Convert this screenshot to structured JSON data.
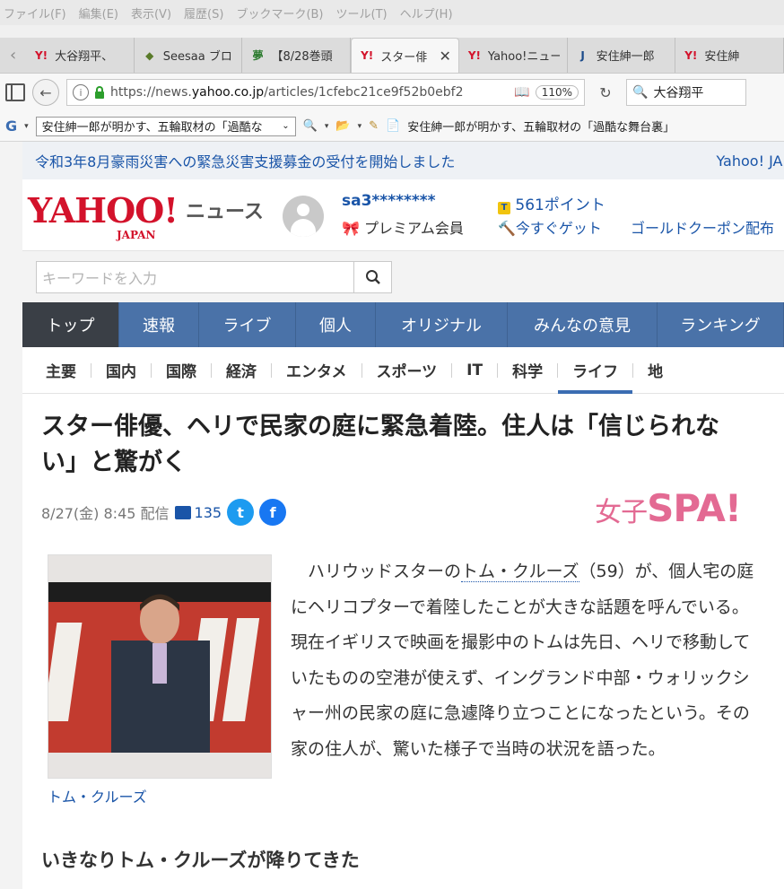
{
  "menubar": [
    "ファイル(F)",
    "編集(E)",
    "表示(V)",
    "履歴(S)",
    "ブックマーク(B)",
    "ツール(T)",
    "ヘルプ(H)"
  ],
  "tabs": [
    {
      "label": "大谷翔平、",
      "favicon": "Y!",
      "active": false,
      "color": "#d3122b"
    },
    {
      "label": "Seesaa ブロ",
      "favicon": "◆",
      "active": false,
      "color": "#5a7b2a"
    },
    {
      "label": "【8/28巻頭",
      "favicon": "夢",
      "active": false,
      "color": "#2b7b2e"
    },
    {
      "label": "スター俳",
      "favicon": "Y!",
      "active": true,
      "color": "#d3122b"
    },
    {
      "label": "Yahoo!ニュー",
      "favicon": "Y!",
      "active": false,
      "color": "#d3122b"
    },
    {
      "label": "安住紳一郎",
      "favicon": "J",
      "active": false,
      "color": "#1a4a8a"
    },
    {
      "label": "安住紳",
      "favicon": "Y!",
      "active": false,
      "color": "#d3122b"
    }
  ],
  "nav": {
    "url_prefix": "https://news.",
    "url_domain": "yahoo.co.jp",
    "url_path": "/articles/1cfebc21ce9f52b0ebf2",
    "zoom": "110%",
    "search_value": "大谷翔平"
  },
  "bookmarks": {
    "select_label": "安住紳一郎が明かす、五輪取材の「過酷な",
    "bookmark_item": "安住紳一郎が明かす、五輪取材の「過酷な舞台裏」"
  },
  "notice": {
    "text": "令和3年8月豪雨災害への緊急災害支援募金の受付を開始しました",
    "right": "Yahoo! JAPAN"
  },
  "header": {
    "logo": "YAHOO!",
    "logo_sub": "JAPAN",
    "news": "ニュース",
    "username": "sa3********",
    "premium": "プレミアム会員",
    "points": "561ポイント",
    "get_now": "今すぐゲット",
    "gold": "ゴールドクーポン配布"
  },
  "search": {
    "placeholder": "キーワードを入力"
  },
  "gnav": [
    {
      "label": "トップ",
      "active": true
    },
    {
      "label": "速報",
      "active": false
    },
    {
      "label": "ライブ",
      "active": false
    },
    {
      "label": "個人",
      "active": false
    },
    {
      "label": "オリジナル",
      "active": false
    },
    {
      "label": "みんなの意見",
      "active": false
    },
    {
      "label": "ランキング",
      "active": false
    }
  ],
  "subnav": [
    {
      "label": "主要",
      "active": false
    },
    {
      "label": "国内",
      "active": false
    },
    {
      "label": "国際",
      "active": false
    },
    {
      "label": "経済",
      "active": false
    },
    {
      "label": "エンタメ",
      "active": false
    },
    {
      "label": "スポーツ",
      "active": false
    },
    {
      "label": "IT",
      "active": false
    },
    {
      "label": "科学",
      "active": false
    },
    {
      "label": "ライフ",
      "active": true
    },
    {
      "label": "地",
      "active": false
    }
  ],
  "article": {
    "headline": "スター俳優、ヘリで民家の庭に緊急着陸。住人は「信じられない」と驚がく",
    "date": "8/27(金) 8:45 配信",
    "comment_count": "135",
    "brand_small": "女子",
    "brand": "SPA!",
    "photo_caption": "トム・クルーズ",
    "body_start": "ハリウッドスターの",
    "body_link": "トム・クルーズ",
    "body_rest": "（59）が、個人宅の庭にヘリコプターで着陸したことが大きな話題を呼んでいる。現在イギリスで映画を撮影中のトムは先日、ヘリで移動していたものの空港が使えず、イングランド中部・ウォリックシャー州の民家の庭に急遽降り立つことになったという。その家の住人が、驚いた様子で当時の状況を語った。",
    "subhead": "いきなりトム・クルーズが降りてきた"
  }
}
